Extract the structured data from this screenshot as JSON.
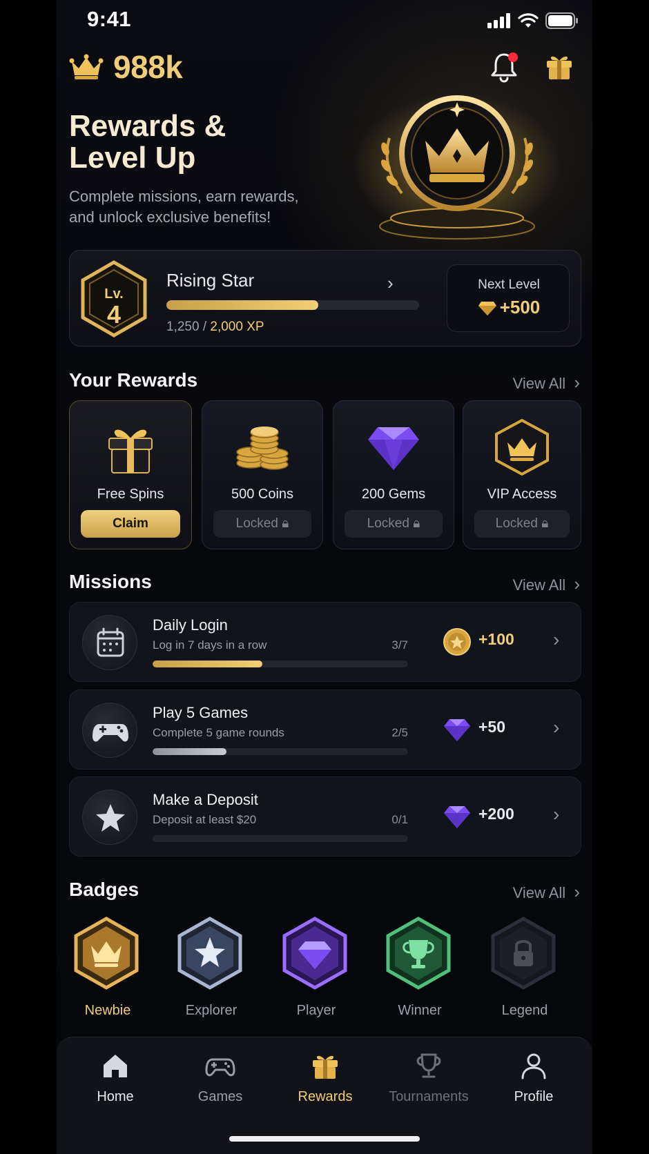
{
  "status": {
    "time": "9:41"
  },
  "header": {
    "balance": "988k"
  },
  "hero": {
    "title_line1": "Rewards &",
    "title_line2": "Level Up",
    "subtitle_line1": "Complete missions, earn rewards,",
    "subtitle_line2": "and unlock exclusive benefits!"
  },
  "level": {
    "lv_label": "Lv.",
    "number": "4",
    "name": "Rising Star",
    "xp_current": "1,250",
    "xp_separator": " / ",
    "xp_target": "2,000 XP",
    "progress": 0.6,
    "next_label": "Next Level",
    "next_value": "+500"
  },
  "rewards": {
    "title": "Your Rewards",
    "view_all": "View All",
    "items": [
      {
        "label": "Free Spins",
        "button": "Claim",
        "state": "claim",
        "icon": "gift-icon"
      },
      {
        "label": "500 Coins",
        "button": "Locked",
        "state": "locked",
        "icon": "coins-icon"
      },
      {
        "label": "200 Gems",
        "button": "Locked",
        "state": "locked",
        "icon": "gem-icon"
      },
      {
        "label": "VIP Access",
        "button": "Locked",
        "state": "locked",
        "icon": "vip-crown-icon"
      }
    ]
  },
  "missions": {
    "title": "Missions",
    "view_all": "View All",
    "items": [
      {
        "title": "Daily Login",
        "desc": "Log in 7 days in a row",
        "count": "3/7",
        "progress": 0.43,
        "reward": "+100",
        "reward_type": "coin",
        "icon": "calendar-icon"
      },
      {
        "title": "Play 5 Games",
        "desc": "Complete 5 game rounds",
        "count": "2/5",
        "progress": 0.29,
        "reward": "+50",
        "reward_type": "gem",
        "icon": "gamepad-icon"
      },
      {
        "title": "Make a Deposit",
        "desc": "Deposit at least $20",
        "count": "0/1",
        "progress": 0,
        "reward": "+200",
        "reward_type": "gem",
        "icon": "star-icon"
      }
    ]
  },
  "badges": {
    "title": "Badges",
    "view_all": "View All",
    "items": [
      {
        "label": "Newbie",
        "icon": "crown-badge-icon"
      },
      {
        "label": "Explorer",
        "icon": "star-badge-icon"
      },
      {
        "label": "Player",
        "icon": "gem-badge-icon"
      },
      {
        "label": "Winner",
        "icon": "trophy-badge-icon"
      },
      {
        "label": "Legend",
        "icon": "lock-badge-icon"
      }
    ]
  },
  "nav": {
    "items": [
      {
        "label": "Home",
        "icon": "home-icon"
      },
      {
        "label": "Games",
        "icon": "gamepad-icon"
      },
      {
        "label": "Rewards",
        "icon": "gift-icon"
      },
      {
        "label": "Tournaments",
        "icon": "trophy-icon"
      },
      {
        "label": "Profile",
        "icon": "profile-icon"
      }
    ]
  },
  "colors": {
    "gold": "#f0cd78",
    "background": "#07080c",
    "gem": "#8a5cff",
    "notification": "#ff2a3a"
  }
}
